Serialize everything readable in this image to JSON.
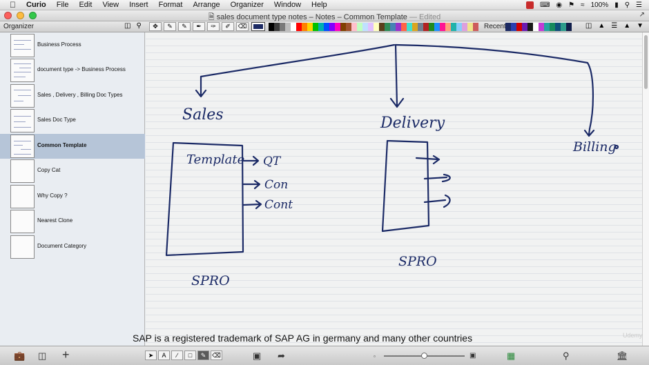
{
  "menubar": {
    "app_name": "Curio",
    "items": [
      "File",
      "Edit",
      "View",
      "Insert",
      "Format",
      "Arrange",
      "Organizer",
      "Window",
      "Help"
    ],
    "battery": "100%"
  },
  "window": {
    "title": "sales document type notes – Notes – Common Template",
    "edited_label": "— Edited"
  },
  "toolbar": {
    "organizer_label": "Organizer",
    "recent_label": "Recent",
    "active_color": "#1c2a63",
    "palette": [
      "#000000",
      "#3b3b3b",
      "#7a7a7a",
      "#bdbdbd",
      "#ffffff",
      "#ff0000",
      "#ff8000",
      "#ffd400",
      "#00c000",
      "#00b0b0",
      "#0050ff",
      "#8000ff",
      "#ff00c0",
      "#804000",
      "#a0522d",
      "#ffc0cb",
      "#c0ffc0",
      "#c0e0ff",
      "#e0c0ff",
      "#ffffc0",
      "#5a3e1b",
      "#2e8b57",
      "#4682b4",
      "#9932cc",
      "#ff6347",
      "#40e0d0",
      "#daa520",
      "#708090",
      "#b22222",
      "#228b22",
      "#1e90ff",
      "#ff1493",
      "#ffa07a",
      "#20b2aa",
      "#87cefa",
      "#dda0dd",
      "#f0e68c",
      "#cd5c5c"
    ],
    "recent_colors": [
      "#1c2a63",
      "#2b3fb0",
      "#d10000",
      "#6a1bb0",
      "#1a1a1a",
      "#ffffff",
      "#c33bd6",
      "#26a4a0",
      "#178a5c",
      "#0f4f7a",
      "#2c9b8b",
      "#101d4a"
    ]
  },
  "organizer": {
    "selected_index": 4,
    "items": [
      {
        "label": "Business Process"
      },
      {
        "label": "document type -> Business Process"
      },
      {
        "label": "Sales , Delivery , Billing Doc Types"
      },
      {
        "label": "Sales Doc Type"
      },
      {
        "label": "Common Template"
      },
      {
        "label": "Copy Cat"
      },
      {
        "label": "Why Copy ?"
      },
      {
        "label": "Nearest Clone"
      },
      {
        "label": "Document Category"
      }
    ]
  },
  "canvas": {
    "ink_color": "#1b2a66",
    "labels": {
      "sales": "Sales",
      "delivery": "Delivery",
      "billing": "Billing",
      "template": "Template",
      "qt": "QT",
      "con": "Con",
      "cont": "Cont",
      "spro1": "SPRO",
      "spro2": "SPRO"
    }
  },
  "caption": "SAP is a registered trademark of SAP AG in germany and many other countries",
  "watermark": "Udemy"
}
